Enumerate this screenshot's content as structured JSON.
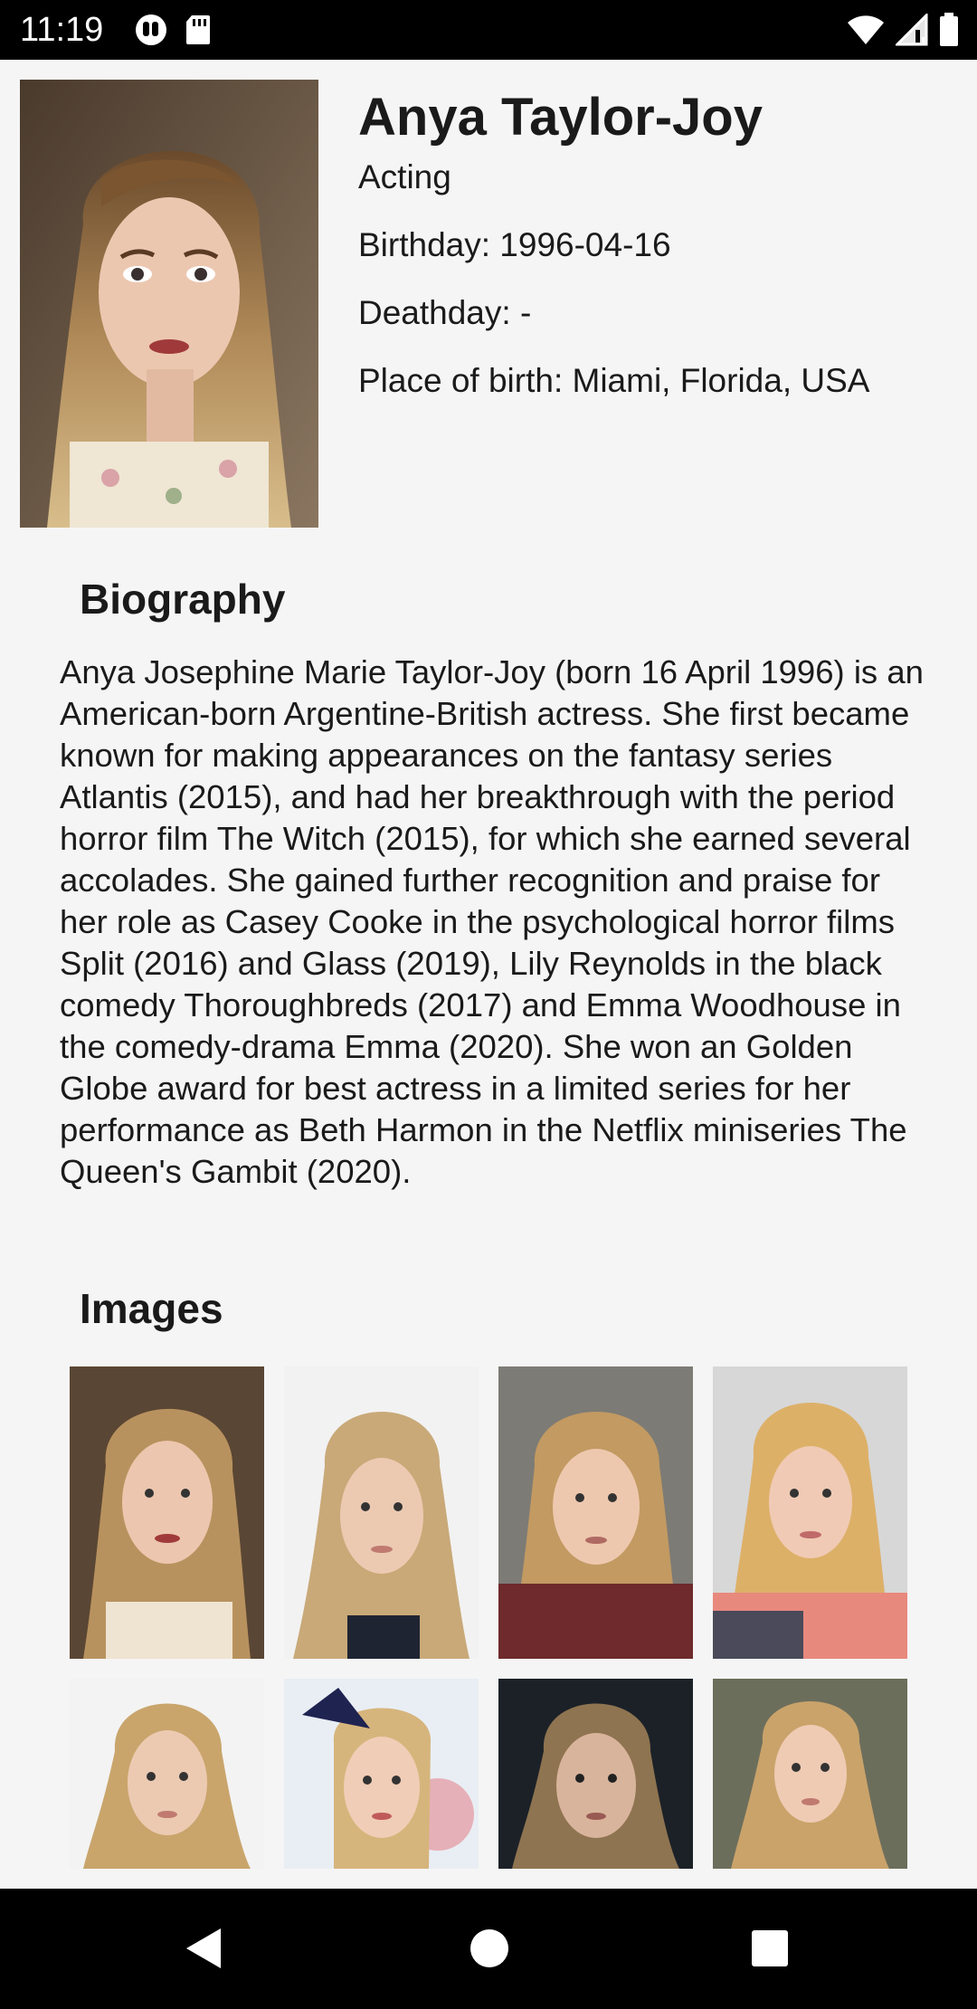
{
  "status_bar": {
    "time": "11:19",
    "left_icons": [
      "media-icon",
      "sd-card-icon"
    ],
    "right_icons": [
      "wifi-icon",
      "signal-icon",
      "battery-icon"
    ]
  },
  "person": {
    "name": "Anya Taylor-Joy",
    "department": "Acting",
    "birthday": "Birthday: 1996-04-16",
    "deathday": "Deathday: -",
    "place_of_birth": "Place of birth: Miami, Florida, USA"
  },
  "biography": {
    "title": "Biography",
    "text": "Anya Josephine Marie Taylor-Joy (born 16 April 1996) is an American-born Argentine-British actress. She first became known for making appearances on the fantasy series Atlantis (2015), and had her breakthrough with the period horror film The Witch (2015), for which she earned several accolades. She gained further recognition and praise for her role as Casey Cooke in the psychological horror films Split (2016) and Glass (2019), Lily Reynolds in the black comedy Thoroughbreds (2017) and Emma Woodhouse in the comedy-drama Emma (2020). She won an Golden Globe award for best actress in a limited series for her performance as Beth Harmon in the Netflix miniseries The Queen's Gambit (2020)."
  },
  "images": {
    "title": "Images"
  },
  "colors": {
    "background": "#f5f5f5",
    "bars": "#000000",
    "text": "#1a1a1a"
  },
  "nav_bar": {
    "icons": [
      "back-icon",
      "home-icon",
      "recents-icon"
    ]
  }
}
